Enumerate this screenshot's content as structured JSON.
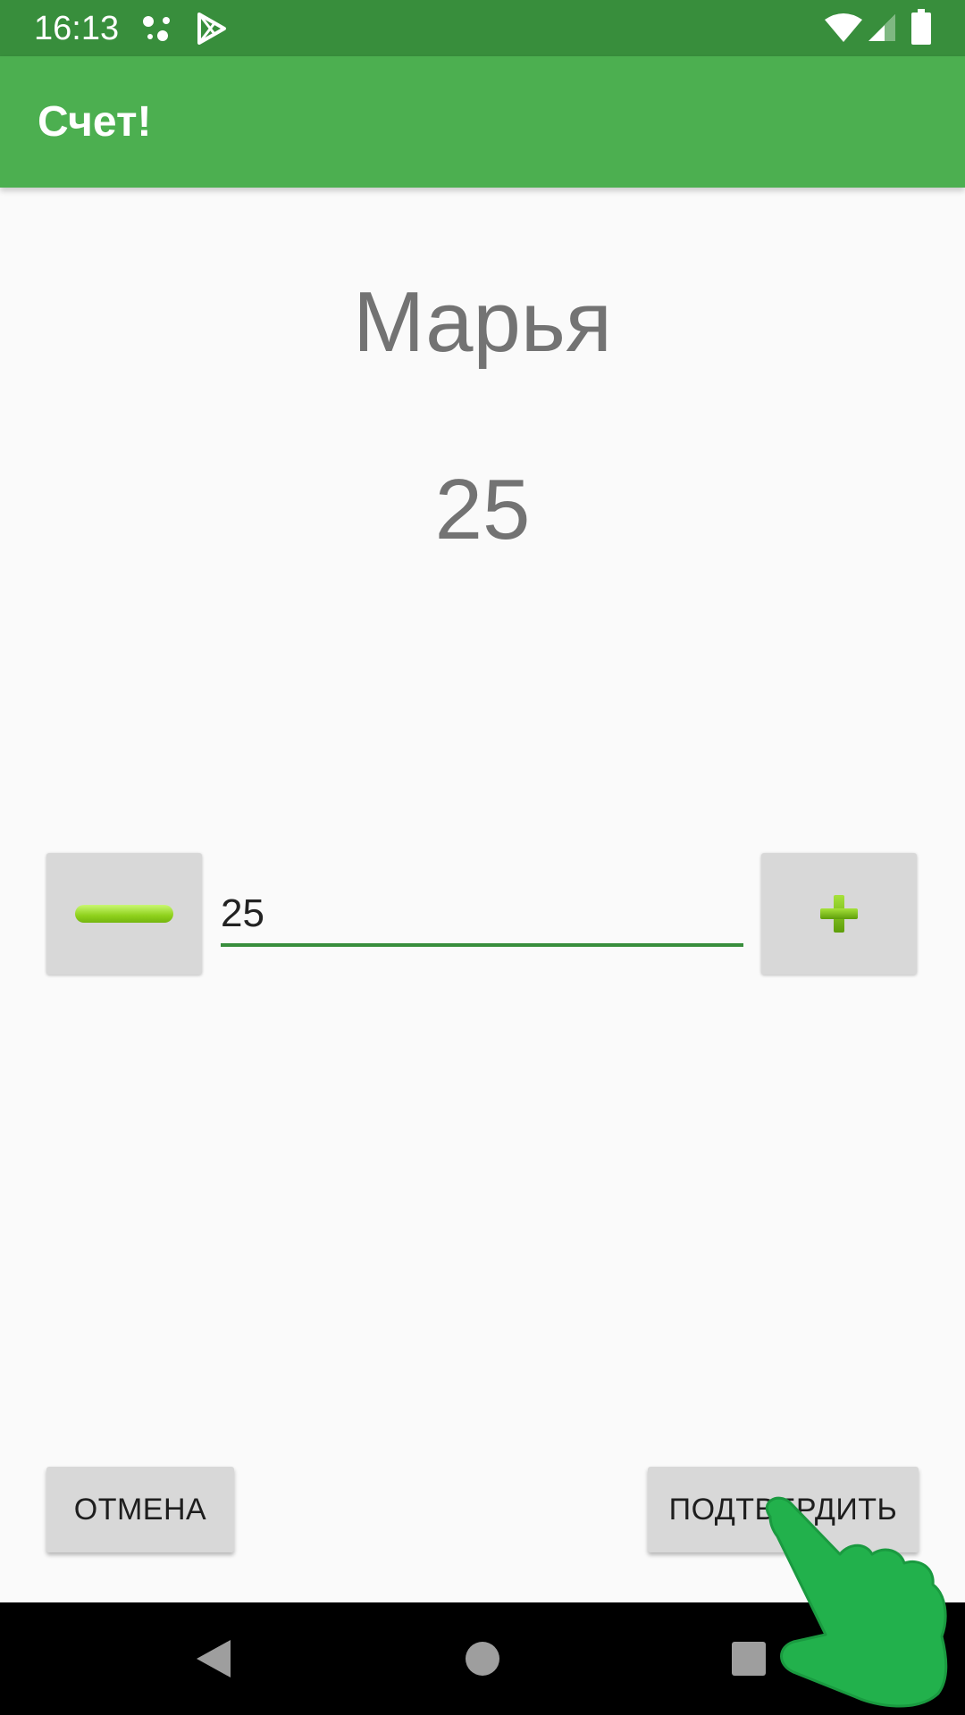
{
  "status_bar": {
    "time": "16:13",
    "icons": [
      "assistant-icon",
      "play-store-icon",
      "wifi-icon",
      "signal-icon",
      "battery-icon"
    ],
    "color": "#388e3c"
  },
  "app_bar": {
    "title": "Счет!",
    "color": "#4caf50"
  },
  "player": {
    "name": "Марья",
    "score": "25"
  },
  "score_editor": {
    "decrement_icon": "minus-icon",
    "value": "25",
    "increment_icon": "plus-icon",
    "accent_color": "#388e3c"
  },
  "actions": {
    "cancel_label": "ОТМЕНА",
    "confirm_label": "ПОДТВЕРДИТЬ"
  },
  "nav_bar": {
    "icons": [
      "back-icon",
      "home-icon",
      "recents-icon"
    ]
  },
  "overlay": {
    "icon": "tap-hand-icon",
    "color": "#22b14c"
  }
}
